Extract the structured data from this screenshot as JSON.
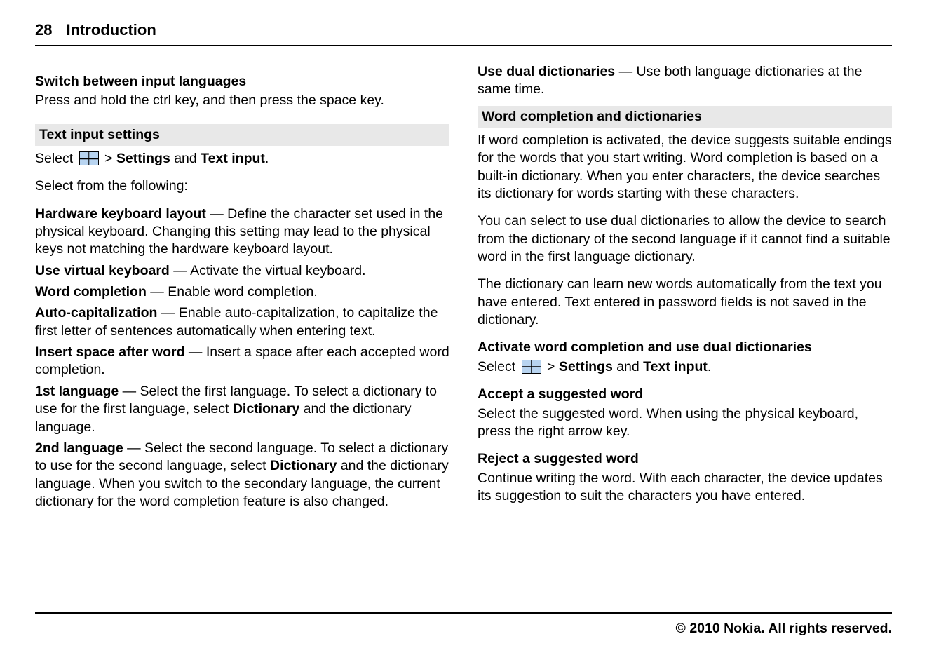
{
  "header": {
    "page_number": "28",
    "section_title": "Introduction"
  },
  "left_column": {
    "switch_heading": "Switch between input languages",
    "switch_body": "Press and hold the ctrl key, and then press the space key.",
    "text_input_heading": "Text input settings",
    "select_prefix": "Select ",
    "select_gt": " > ",
    "settings_label": "Settings",
    "and_text": " and ",
    "text_input_label": "Text input",
    "period": ".",
    "select_following": "Select from the following:",
    "defs": {
      "hw_kb_term": "Hardware keyboard layout",
      "hw_kb_body": "  — Define the character set used in the physical keyboard. Changing this setting may lead to the physical keys not matching the hardware keyboard layout.",
      "virt_kb_term": "Use virtual keyboard",
      "virt_kb_body": "  — Activate the virtual keyboard.",
      "word_comp_term": "Word completion",
      "word_comp_body": "  — Enable word completion.",
      "auto_cap_term": "Auto-capitalization",
      "auto_cap_body": "  — Enable auto-capitalization, to capitalize the first letter of sentences automatically when entering text.",
      "insert_space_term": "Insert space after word",
      "insert_space_body": "  — Insert a space after each accepted word completion.",
      "first_lang_term": "1st language",
      "first_lang_body_a": "  — Select the first language. To select a dictionary to use for the first language, select ",
      "dictionary_label": "Dictionary",
      "first_lang_body_b": " and the dictionary language.",
      "second_lang_term": "2nd language",
      "second_lang_body_a": "  — Select the second language. To select a dictionary to use for the second language, select ",
      "second_lang_body_b": " and the dictionary language. When you switch to the secondary language, the current dictionary for the word completion feature is also changed."
    }
  },
  "right_column": {
    "dual_dict_term": "Use dual dictionaries",
    "dual_dict_body": "  — Use both language dictionaries at the same time.",
    "word_comp_heading": "Word completion and dictionaries",
    "para1": "If word completion is activated, the device suggests suitable endings for the words that you start writing. Word completion is based on a built-in dictionary. When you enter characters, the device searches its dictionary for words starting with these characters.",
    "para2": "You can select to use dual dictionaries to allow the device to search from the dictionary of the second language if it cannot find a suitable word in the first language dictionary.",
    "para3": "The dictionary can learn new words automatically from the text you have entered. Text entered in password fields is not saved in the dictionary.",
    "activate_heading": "Activate word completion and use dual dictionaries",
    "select_prefix": "Select ",
    "select_gt": " > ",
    "settings_label": "Settings",
    "and_text": " and ",
    "text_input_label": "Text input",
    "period": ".",
    "accept_heading": "Accept a suggested word",
    "accept_body": "Select the suggested word. When using the physical keyboard, press the right arrow key.",
    "reject_heading": "Reject a suggested word",
    "reject_body": "Continue writing the word. With each character, the device updates its suggestion to suit the characters you have entered."
  },
  "footer": {
    "copyright": "© 2010 Nokia. All rights reserved."
  }
}
